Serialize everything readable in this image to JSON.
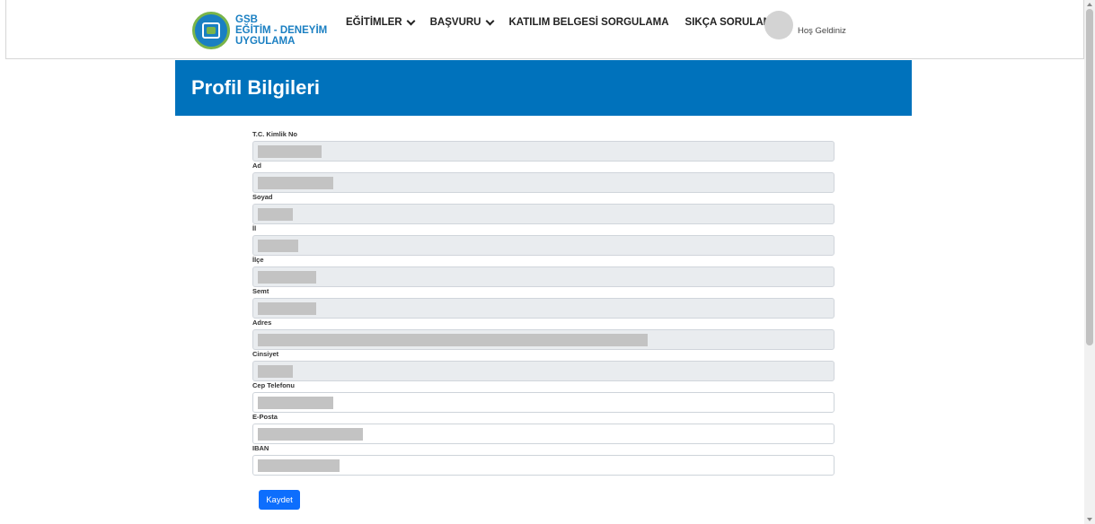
{
  "header": {
    "logo": {
      "line1": "GSB",
      "line2": "EĞİTİM - DENEYİM",
      "line3": "UYGULAMA"
    },
    "nav": [
      {
        "label": "EĞİTİMLER",
        "has_dropdown": true
      },
      {
        "label": "BAŞVURU",
        "has_dropdown": true
      },
      {
        "label": "KATILIM BELGESİ SORGULAMA",
        "has_dropdown": false
      },
      {
        "label": "SIKÇA SORULANLAR",
        "has_dropdown": false
      }
    ],
    "welcome": "Hoş Geldiniz"
  },
  "banner": {
    "title": "Profil Bilgileri"
  },
  "form": {
    "fields": [
      {
        "label": "T.C. Kimlik No",
        "value": "",
        "readonly": true,
        "redacted_fraction": 0.11
      },
      {
        "label": "Ad",
        "value": "",
        "readonly": true,
        "redacted_fraction": 0.13
      },
      {
        "label": "Soyad",
        "value": "",
        "readonly": true,
        "redacted_fraction": 0.06
      },
      {
        "label": "İl",
        "value": "",
        "readonly": true,
        "redacted_fraction": 0.07
      },
      {
        "label": "İlçe",
        "value": "",
        "readonly": true,
        "redacted_fraction": 0.1
      },
      {
        "label": "Semt",
        "value": "",
        "readonly": true,
        "redacted_fraction": 0.1
      },
      {
        "label": "Adres",
        "value": "",
        "readonly": true,
        "redacted_fraction": 0.67
      },
      {
        "label": "Cinsiyet",
        "value": "",
        "readonly": true,
        "redacted_fraction": 0.06
      },
      {
        "label": "Cep Telefonu",
        "value": "",
        "readonly": false,
        "redacted_fraction": 0.13
      },
      {
        "label": "E-Posta",
        "value": "",
        "readonly": false,
        "redacted_fraction": 0.18
      },
      {
        "label": "IBAN",
        "value": "",
        "readonly": false,
        "redacted_fraction": 0.14
      }
    ],
    "submit_label": "Kaydet"
  },
  "colors": {
    "primary": "#0072bc",
    "button": "#0d6efd",
    "readonly_bg": "#e9ecef"
  }
}
